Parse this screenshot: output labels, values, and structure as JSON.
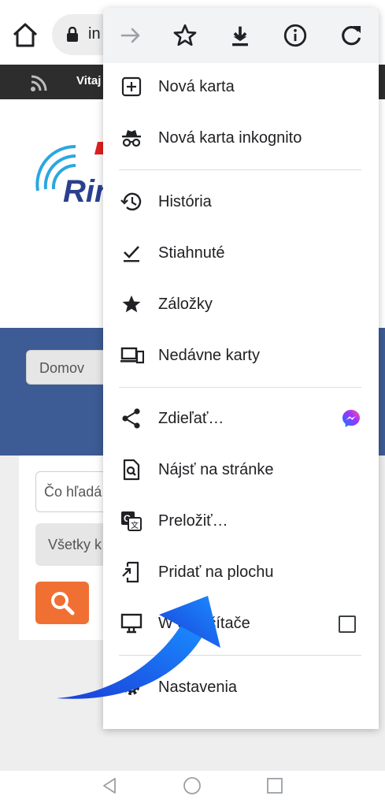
{
  "browser": {
    "url_visible": "in"
  },
  "page": {
    "welcome_text": "Vitaj",
    "logo_text": "Rin",
    "nav_button": "Domov",
    "search_placeholder": "Čo hľadá",
    "category_select": "Všetky k"
  },
  "menu": {
    "toolbar": [
      "forward-icon",
      "bookmark-star-icon",
      "download-icon",
      "info-icon",
      "reload-icon"
    ],
    "items": [
      {
        "label": "Nová karta",
        "icon": "new-tab-icon"
      },
      {
        "label": "Nová karta inkognito",
        "icon": "incognito-icon"
      },
      {
        "label": "História",
        "icon": "history-icon"
      },
      {
        "label": "Stiahnuté",
        "icon": "downloads-icon"
      },
      {
        "label": "Záložky",
        "icon": "bookmarks-star-icon"
      },
      {
        "label": "Nedávne karty",
        "icon": "recent-tabs-icon"
      },
      {
        "label": "Zdieľať…",
        "icon": "share-icon"
      },
      {
        "label": "Nájsť na stránke",
        "icon": "find-in-page-icon"
      },
      {
        "label": "Preložiť…",
        "icon": "translate-icon"
      },
      {
        "label": "Pridať na plochu",
        "icon": "add-to-home-icon"
      },
      {
        "label": "W          e počítače",
        "icon": "desktop-icon"
      },
      {
        "label": "Nastavenia",
        "icon": "settings-icon"
      }
    ]
  },
  "colors": {
    "band": "#3d5b94",
    "search_button": "#f07033",
    "arrow": "#1a56f0"
  }
}
